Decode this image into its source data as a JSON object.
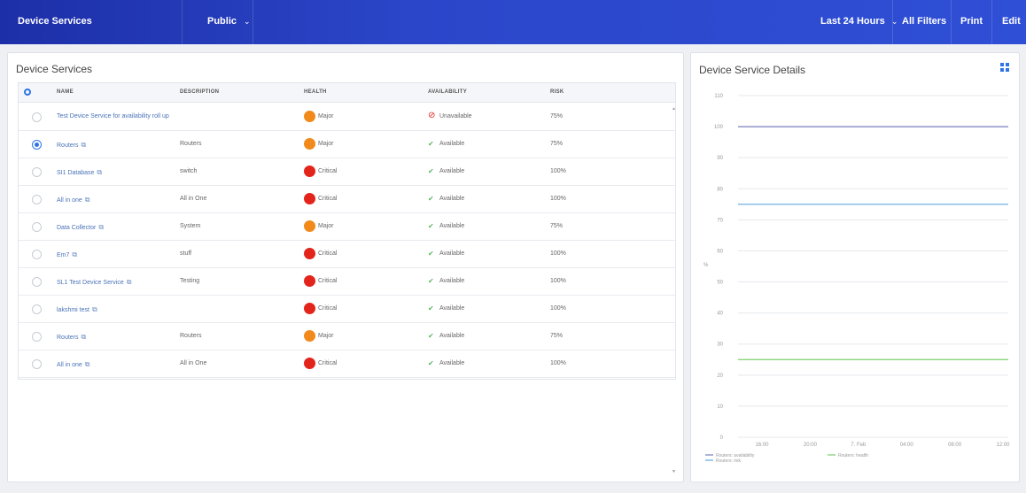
{
  "topbar": {
    "title": "Device Services",
    "visibility": "Public",
    "visibility_chevron": "⌄",
    "time_range": "Last 24 Hours",
    "time_chevron": "⌄",
    "filters": "All Filters",
    "print": "Print",
    "edit": "Edit"
  },
  "list": {
    "title": "Device Services",
    "columns": [
      "NAME",
      "DESCRIPTION",
      "HEALTH",
      "AVAILABILITY",
      "RISK"
    ],
    "rows": [
      {
        "name": "Test Device Service for availability roll up",
        "ext": false,
        "description": "",
        "health": "Major",
        "availability": "Unavailable",
        "risk": "75%",
        "selected": false
      },
      {
        "name": "Routers",
        "ext": true,
        "description": "Routers",
        "health": "Major",
        "availability": "Available",
        "risk": "75%",
        "selected": true
      },
      {
        "name": "SI1 Database",
        "ext": true,
        "description": "switch",
        "health": "Critical",
        "availability": "Available",
        "risk": "100%",
        "selected": false
      },
      {
        "name": "All in one",
        "ext": true,
        "description": "All in One",
        "health": "Critical",
        "availability": "Available",
        "risk": "100%",
        "selected": false
      },
      {
        "name": "Data Collector",
        "ext": true,
        "description": "System",
        "health": "Major",
        "availability": "Available",
        "risk": "75%",
        "selected": false
      },
      {
        "name": "Em7",
        "ext": true,
        "description": "stuff",
        "health": "Critical",
        "availability": "Available",
        "risk": "100%",
        "selected": false
      },
      {
        "name": "SL1 Test Device Service",
        "ext": true,
        "description": "Testing",
        "health": "Critical",
        "availability": "Available",
        "risk": "100%",
        "selected": false
      },
      {
        "name": "lakshmi test",
        "ext": true,
        "description": "",
        "health": "Critical",
        "availability": "Available",
        "risk": "100%",
        "selected": false
      },
      {
        "name": "Routers",
        "ext": true,
        "description": "Routers",
        "health": "Major",
        "availability": "Available",
        "risk": "75%",
        "selected": false
      },
      {
        "name": "All in one",
        "ext": true,
        "description": "All in One",
        "health": "Critical",
        "availability": "Available",
        "risk": "100%",
        "selected": false
      }
    ],
    "colors": {
      "major": "#f2891b",
      "critical": "#e3241b",
      "available": "#5cb85c",
      "unavailable": "#e3241b"
    }
  },
  "details": {
    "title": "Device Service Details",
    "icon": "grid-view-icon"
  },
  "chart_data": {
    "type": "line",
    "title": "",
    "ylabel": "%",
    "ylim": [
      0,
      110
    ],
    "yticks": [
      0,
      10,
      20,
      30,
      40,
      50,
      60,
      70,
      80,
      90,
      100,
      110
    ],
    "x_ticks": [
      "16:00",
      "20:00",
      "7. Feb",
      "04:00",
      "08:00",
      "12:00"
    ],
    "grid": true,
    "series": [
      {
        "name": "Routers: availability",
        "values": [
          100,
          100
        ],
        "color": "#7b7fbf"
      },
      {
        "name": "Routers: health",
        "values": [
          25,
          25
        ],
        "color": "#7ccf6d"
      },
      {
        "name": "Routers: risk",
        "values": [
          75,
          75
        ],
        "color": "#62a8e0"
      }
    ],
    "legend_placement": "bottom-left"
  }
}
